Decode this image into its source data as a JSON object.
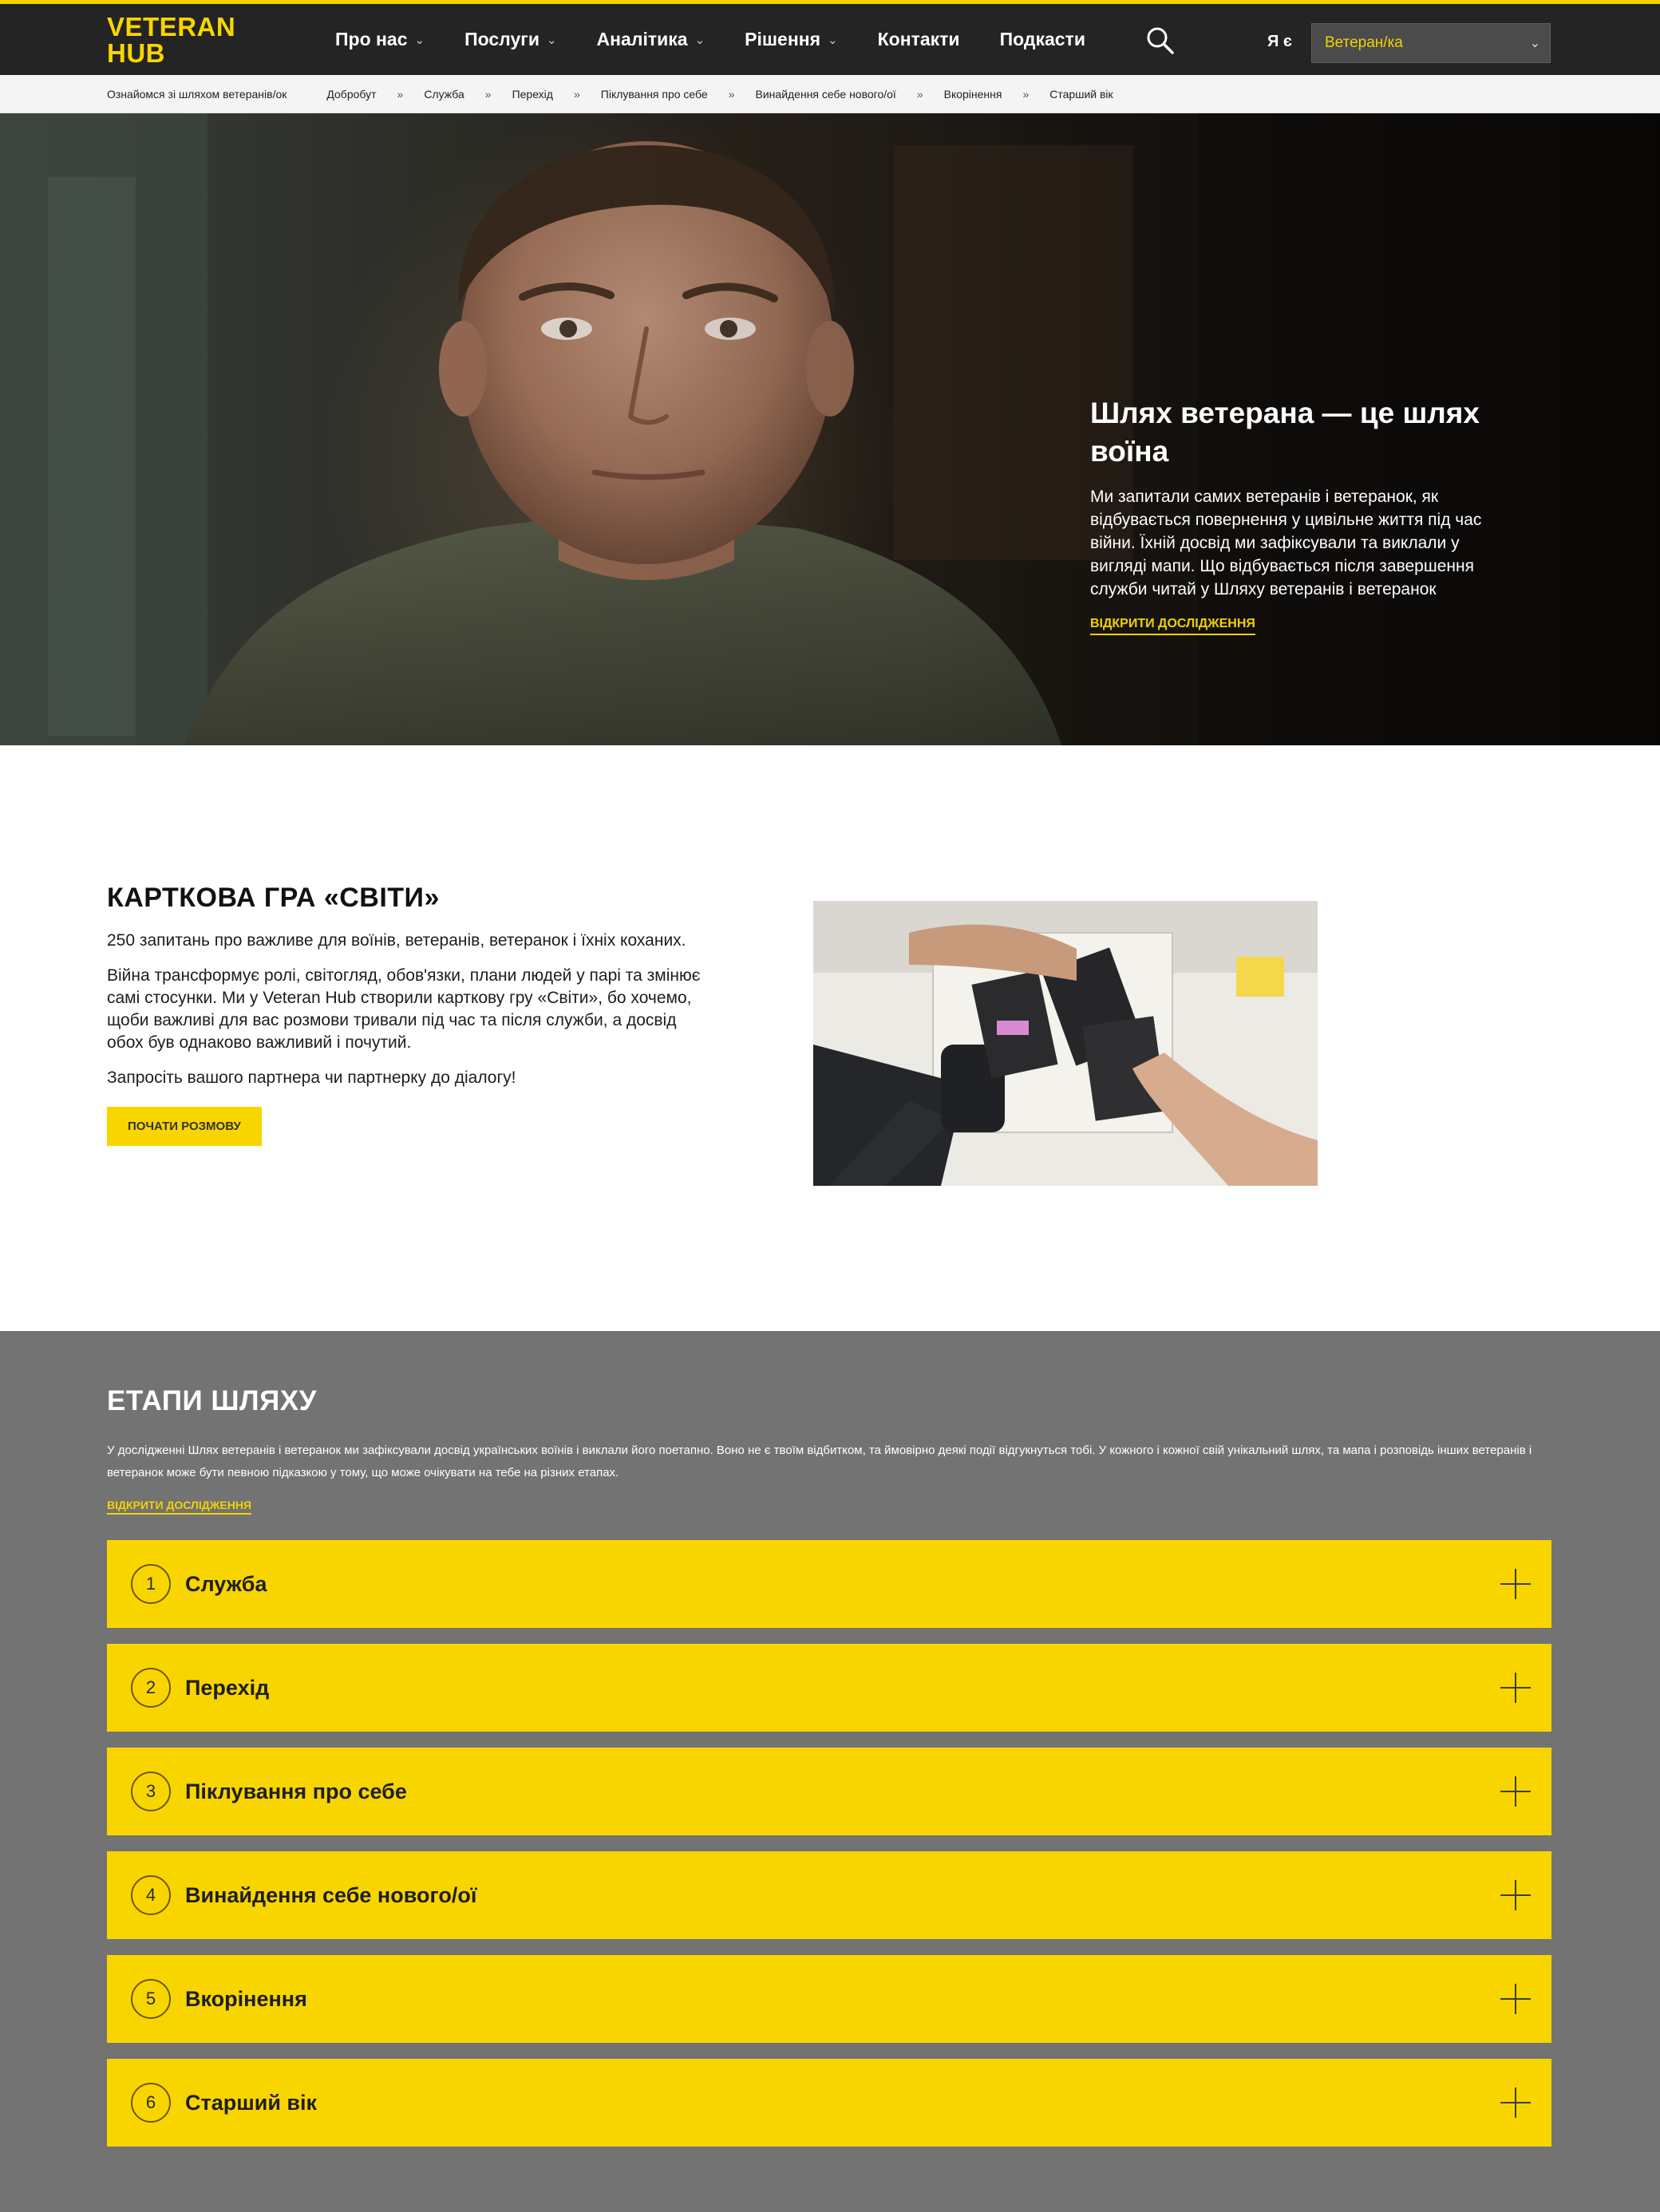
{
  "header": {
    "logo_line1": "VETERAN",
    "logo_line2": "HUB",
    "nav": [
      {
        "label": "Про нас",
        "has_dropdown": true
      },
      {
        "label": "Послуги",
        "has_dropdown": true
      },
      {
        "label": "Аналітика",
        "has_dropdown": true
      },
      {
        "label": "Рішення",
        "has_dropdown": true
      },
      {
        "label": "Контакти",
        "has_dropdown": false
      },
      {
        "label": "Подкасти",
        "has_dropdown": false
      }
    ],
    "search_icon": "search-icon",
    "iam_label": "Я є",
    "role_select_value": "Ветеран/ка"
  },
  "path_bar": {
    "intro": "Ознайомся зі шляхом ветеранів/ок",
    "steps": [
      "Добробут",
      "Служба",
      "Перехід",
      "Піклування про себе",
      "Винайдення себе нового/ої",
      "Вкорінення",
      "Старший вік"
    ],
    "separator": "»"
  },
  "hero": {
    "title": "Шлях ветерана — це шлях воїна",
    "body": "Ми запитали самих ветеранів і ветеранок, як відбувається повернення у цивільне життя під час війни. Їхній досвід ми зафіксували та виклали у вигляді мапи. Що відбувається після завершення служби читай у Шляху ветеранів і ветеранок",
    "link": "відкрити дослідження"
  },
  "card_game": {
    "title": "КАРТКОВА ГРА «СВІТИ»",
    "p1": "250 запитань про важливе для воїнів, ветеранів, ветеранок і їхніх коханих.",
    "p2": "Війна трансформує ролі, світогляд, обов'язки, плани людей у парі та змінює самі стосунки. Ми у Veteran Hub створили карткову гру «Світи», бо хочемо, щоби важливі для вас розмови тривали під час та після служби, а досвід обох був однаково важливий і почутий.",
    "p3": "Запросіть вашого партнера чи партнерку до діалогу!",
    "button": "почати розмову"
  },
  "stages": {
    "title": "ЕТАПИ ШЛЯХУ",
    "description": "У дослідженні Шлях ветеранів і ветеранок ми зафіксували досвід українських воїнів і виклали його поетапно. Воно не є твоїм відбитком, та ймовірно деякі події відгукнуться тобі. У кожного і кожної свій унікальний шлях, та мапа і розповідь інших ветеранів і ветеранок може бути певною підказкою у тому, що може очікувати на тебе на різних етапах.",
    "link": "відкрити дослідження",
    "items": [
      {
        "num": "1",
        "label": "Служба"
      },
      {
        "num": "2",
        "label": "Перехід"
      },
      {
        "num": "3",
        "label": "Піклування про себе"
      },
      {
        "num": "4",
        "label": "Винайдення себе нового/ої"
      },
      {
        "num": "5",
        "label": "Вкорінення"
      },
      {
        "num": "6",
        "label": "Старший вік"
      }
    ],
    "expand_icon": "plus-icon"
  },
  "colors": {
    "brand_yellow": "#f9d500",
    "header_bg": "#242424",
    "stages_bg": "#737373"
  }
}
